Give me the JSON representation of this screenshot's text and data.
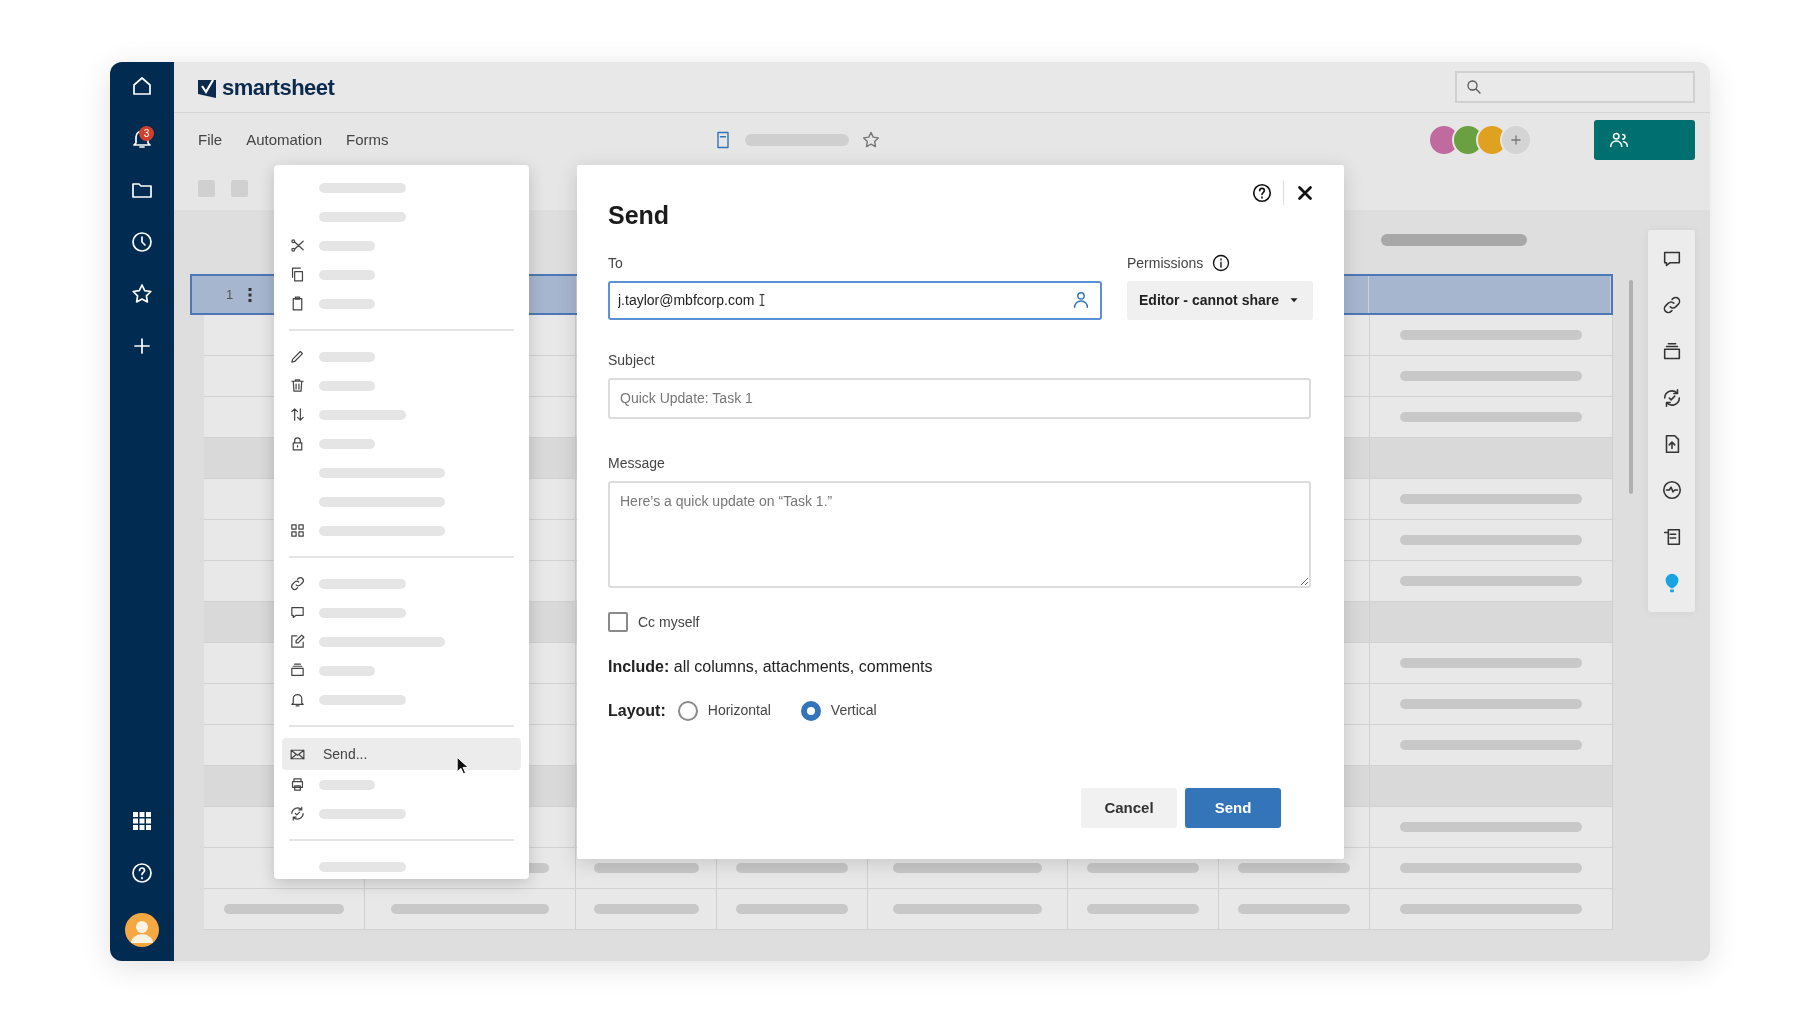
{
  "app": {
    "logo": "smartsheet",
    "notification_count": "3"
  },
  "menu_bar": [
    "File",
    "Automation",
    "Forms"
  ],
  "grid": {
    "rows": [
      {
        "number": "1",
        "selected": true
      }
    ]
  },
  "context_menu": {
    "send_item": {
      "label": "Send...",
      "highlighted": true
    }
  },
  "dialog": {
    "title": "Send",
    "to": {
      "label": "To",
      "value": "j.taylor@mbfcorp.com"
    },
    "permissions": {
      "label": "Permissions",
      "value": "Editor - cannot share"
    },
    "subject": {
      "label": "Subject",
      "placeholder": "Quick Update: Task 1"
    },
    "message": {
      "label": "Message",
      "placeholder": "Here’s a quick update on “Task 1.”"
    },
    "cc": {
      "label": "Cc myself",
      "checked": false
    },
    "include": "**Include:** all columns, attachments, comments",
    "layout": {
      "label": "Layout:",
      "options": [
        {
          "label": "Horizontal",
          "selected": false
        },
        {
          "label": "Vertical",
          "selected": true
        }
      ]
    },
    "buttons": [
      {
        "label": "Cancel",
        "kind": "secondary"
      },
      {
        "label": "Send",
        "kind": "primary"
      }
    ]
  }
}
